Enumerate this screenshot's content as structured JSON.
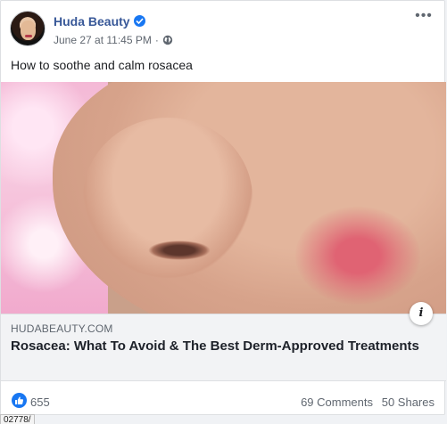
{
  "post": {
    "author": "Huda Beauty",
    "timestamp": "June 27 at 11:45 PM",
    "separator": "·",
    "privacy_icon": "globe-icon",
    "verified_icon": "verified-badge-icon",
    "more_label": "•••",
    "caption": "How to soothe and calm rosacea"
  },
  "link_preview": {
    "domain": "HUDABEAUTY.COM",
    "title": "Rosacea: What To Avoid & The Best Derm-Approved Treatments",
    "info_label": "i"
  },
  "engagement": {
    "reaction_icon": "like-icon",
    "reaction_count": "655",
    "comments": "69 Comments",
    "shares": "50 Shares"
  },
  "status_bar": {
    "url_fragment": "02778/"
  },
  "colors": {
    "brand_blue": "#1877f2",
    "author_link": "#385898",
    "muted_text": "#606770",
    "link_box_bg": "#f2f3f5"
  }
}
